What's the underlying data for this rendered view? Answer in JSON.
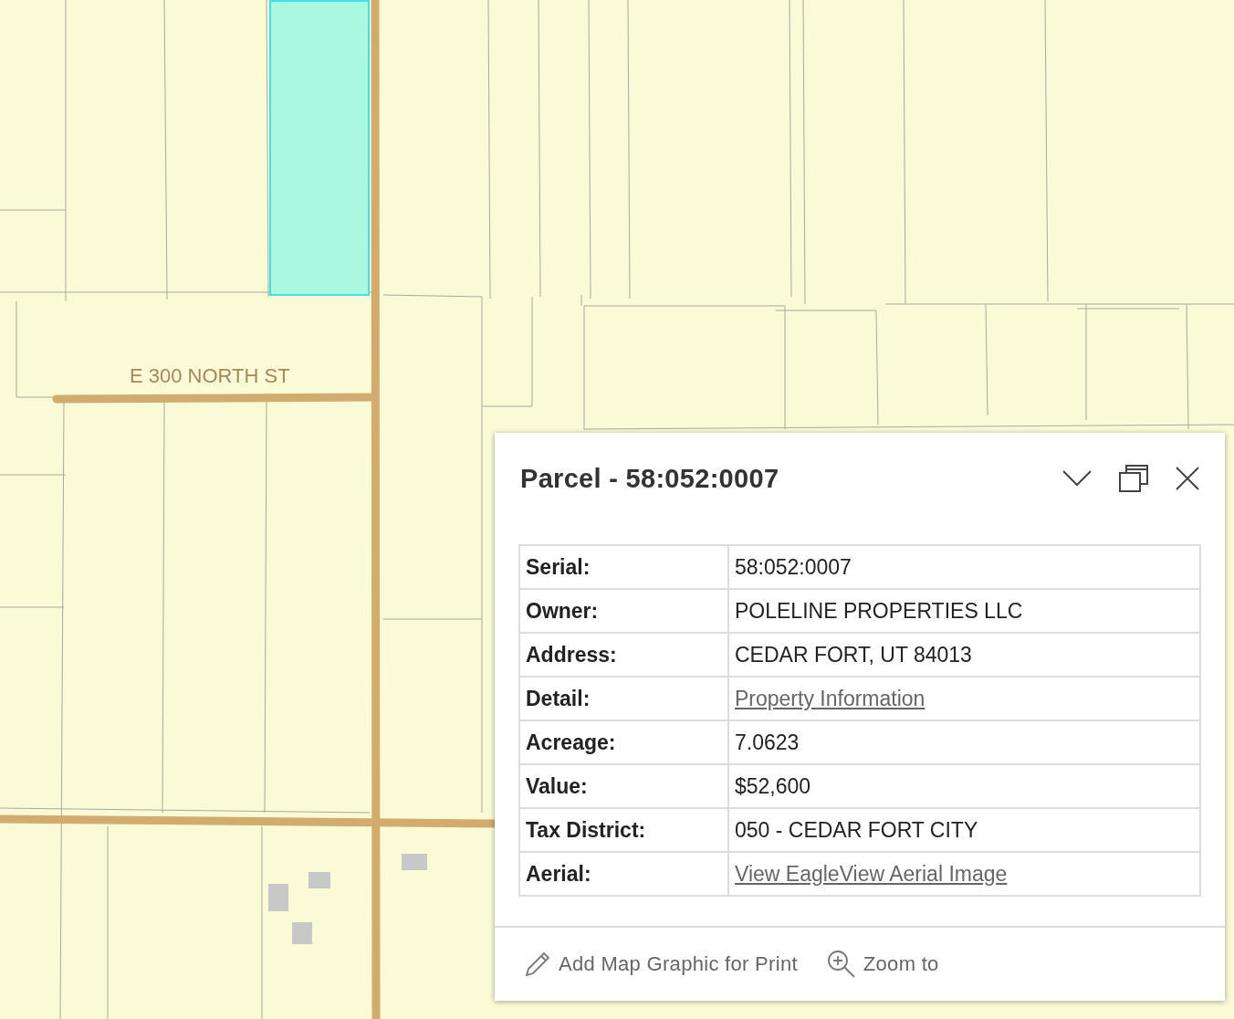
{
  "map": {
    "street_label": "E 300 NORTH ST"
  },
  "popup": {
    "title": "Parcel - 58:052:0007",
    "rows": [
      {
        "label": "Serial:",
        "value": "58:052:0007",
        "kind": "text"
      },
      {
        "label": "Owner:",
        "value": "POLELINE PROPERTIES LLC",
        "kind": "text"
      },
      {
        "label": "Address:",
        "value": "CEDAR FORT, UT 84013",
        "kind": "text"
      },
      {
        "label": "Detail:",
        "value": "Property Information",
        "kind": "link"
      },
      {
        "label": "Acreage:",
        "value": "7.0623",
        "kind": "text"
      },
      {
        "label": "Value:",
        "value": "$52,600",
        "kind": "text"
      },
      {
        "label": "Tax District:",
        "value": "050 - CEDAR FORT CITY",
        "kind": "text"
      },
      {
        "label": "Aerial:",
        "value": "View EagleView Aerial Image",
        "kind": "link"
      }
    ],
    "actions": [
      {
        "label": "Add Map Graphic for Print",
        "kind": "pencil"
      },
      {
        "label": "Zoom to",
        "kind": "zoom"
      }
    ]
  }
}
